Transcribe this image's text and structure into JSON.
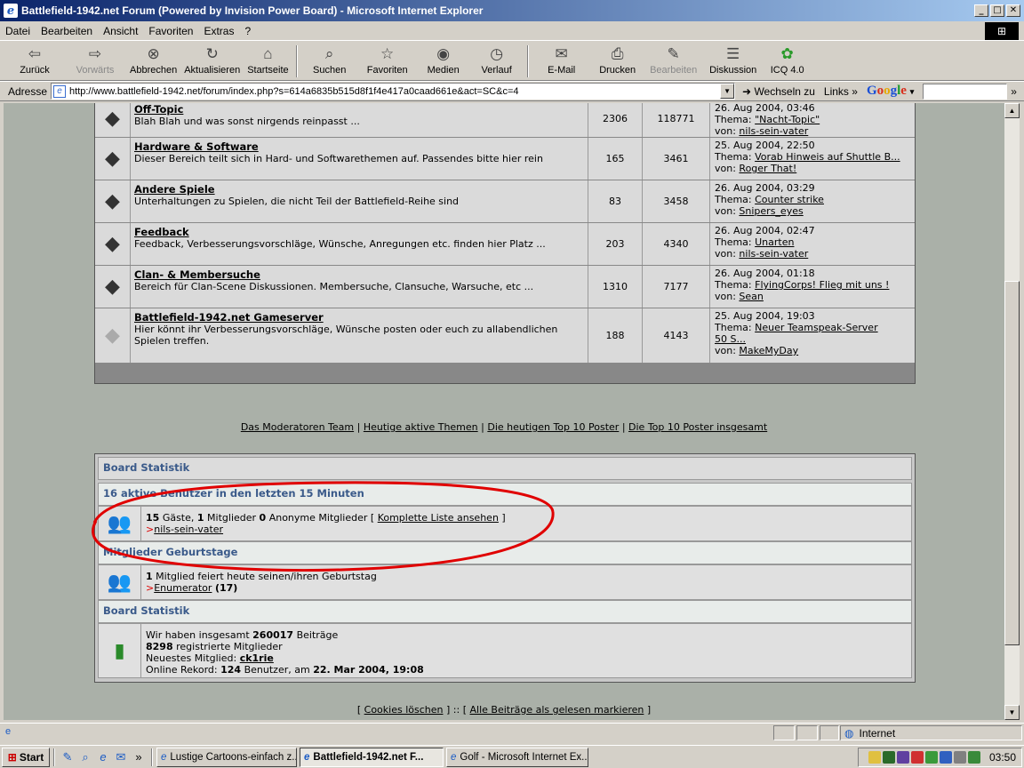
{
  "window": {
    "title": "Battlefield-1942.net Forum (Powered by Invision Power Board) - Microsoft Internet Explorer",
    "min": "_",
    "max": "□",
    "close": "✕"
  },
  "menu": [
    "Datei",
    "Bearbeiten",
    "Ansicht",
    "Favoriten",
    "Extras",
    "?"
  ],
  "toolbar": {
    "back": "Zurück",
    "forward": "Vorwärts",
    "stop": "Abbrechen",
    "refresh": "Aktualisieren",
    "home": "Startseite",
    "search": "Suchen",
    "favorites": "Favoriten",
    "media": "Medien",
    "history": "Verlauf",
    "email": "E-Mail",
    "print": "Drucken",
    "edit": "Bearbeiten",
    "discuss": "Diskussion",
    "icq": "ICQ 4.0"
  },
  "address": {
    "label": "Adresse",
    "url": "http://www.battlefield-1942.net/forum/index.php?s=614a6835b515d8f1f4e417a0caad661e&act=SC&c=4",
    "go": "Wechseln zu",
    "links": "Links",
    "google_letters": [
      "G",
      "o",
      "o",
      "g",
      "l",
      "e"
    ]
  },
  "forums": [
    {
      "name": "Off-Topic",
      "desc": "Blah Blah und was sonst nirgends reinpasst ...",
      "topics": "2306",
      "posts": "118771",
      "last_date": "26. Aug 2004, 03:46",
      "last_topic_label": "Thema:",
      "last_topic": "\"Nacht-Topic\"",
      "last_by_label": "von:",
      "last_by": "nils-sein-vater"
    },
    {
      "name": "Hardware & Software",
      "desc": "Dieser Bereich teilt sich in Hard- und Softwarethemen auf. Passendes bitte hier rein",
      "topics": "165",
      "posts": "3461",
      "last_date": "25. Aug 2004, 22:50",
      "last_topic_label": "Thema:",
      "last_topic": "Vorab Hinweis auf Shuttle B...",
      "last_by_label": "von:",
      "last_by": "Roger That!"
    },
    {
      "name": "Andere Spiele",
      "desc": "Unterhaltungen zu Spielen, die nicht Teil der Battlefield-Reihe sind",
      "topics": "83",
      "posts": "3458",
      "last_date": "26. Aug 2004, 03:29",
      "last_topic_label": "Thema:",
      "last_topic": "Counter strike",
      "last_by_label": "von:",
      "last_by": "Snipers_eyes"
    },
    {
      "name": "Feedback",
      "desc": "Feedback, Verbesserungsvorschläge, Wünsche, Anregungen etc. finden hier Platz ...",
      "topics": "203",
      "posts": "4340",
      "last_date": "26. Aug 2004, 02:47",
      "last_topic_label": "Thema:",
      "last_topic": "Unarten",
      "last_by_label": "von:",
      "last_by": "nils-sein-vater"
    },
    {
      "name": "Clan- & Membersuche",
      "desc": "Bereich für Clan-Scene Diskussionen. Membersuche, Clansuche, Warsuche, etc ...",
      "topics": "1310",
      "posts": "7177",
      "last_date": "26. Aug 2004, 01:18",
      "last_topic_label": "Thema:",
      "last_topic": "FlyingCorps! Flieg mit uns !",
      "last_by_label": "von:",
      "last_by": "Sean"
    },
    {
      "name": "Battlefield-1942.net Gameserver",
      "desc": "Hier könnt ihr Verbesserungsvorschläge, Wünsche posten oder euch zu allabendlichen Spielen treffen.",
      "topics": "188",
      "posts": "4143",
      "last_date": "25. Aug 2004, 19:03",
      "last_topic_label": "Thema:",
      "last_topic": "Neuer Teamspeak-Server 50 S...",
      "last_by_label": "von:",
      "last_by": "MakeMyDay"
    }
  ],
  "modlinks": {
    "team": "Das Moderatoren Team",
    "active": "Heutige aktive Themen",
    "top10today": "Die heutigen Top 10 Poster",
    "top10all": "Die Top 10 Poster insgesamt",
    "sep": "|"
  },
  "stats": {
    "header": "Board Statistik",
    "active_header": "16 aktive Benutzer in den letzten 15 Minuten",
    "guests": "15",
    "guests_label": "Gäste,",
    "members": "1",
    "members_label": "Mitglieder",
    "anon": "0",
    "anon_label": "Anonyme Mitglieder [",
    "full_list": "Komplette Liste ansehen",
    "full_list_end": "]",
    "active_user": "nils-sein-vater",
    "birthday_header": "Mitglieder Geburtstage",
    "bday_count": "1",
    "bday_text": "Mitglied feiert heute seinen/ihren Geburtstag",
    "bday_user": "Enumerator",
    "bday_age": "(17)",
    "board_header": "Board Statistik",
    "total_prefix": "Wir haben insgesamt",
    "total_posts": "260017",
    "total_suffix": "Beiträge",
    "registered": "8298",
    "registered_label": "registrierte Mitglieder",
    "newest_label": "Neuestes Mitglied:",
    "newest": "ck1rie",
    "record_prefix": "Online Rekord:",
    "record_count": "124",
    "record_mid": "Benutzer, am",
    "record_date": "22. Mar 2004, 19:08",
    "marker": ">"
  },
  "bottom": {
    "cookies": "Cookies löschen",
    "mark_read": "Alle Beiträge als gelesen markieren",
    "open": "[",
    "close": "]",
    "sep": "::"
  },
  "status": {
    "zone": "Internet"
  },
  "taskbar": {
    "start": "Start",
    "more": "»",
    "tasks": [
      "Lustige Cartoons-einfach z...",
      "Battlefield-1942.net F...",
      "Golf - Microsoft Internet Ex..."
    ],
    "clock": "03:50"
  },
  "colors": {
    "titlebar": "#0a246a",
    "annotation": "#e00000",
    "link_header": "#3a5a8a"
  }
}
